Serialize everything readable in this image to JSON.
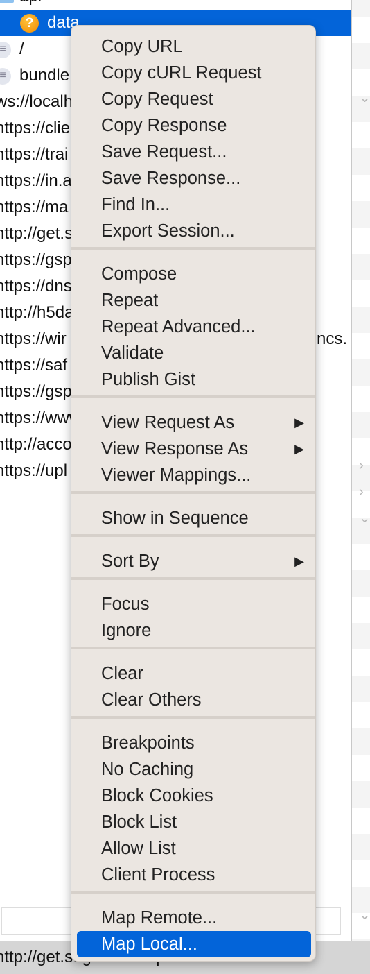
{
  "list": {
    "rows": [
      {
        "text": "api",
        "icon": "folder-icon"
      },
      {
        "text": "data",
        "icon": "question-icon",
        "selected": true
      },
      {
        "text": "/",
        "icon": "document-icon"
      },
      {
        "text": "bundle",
        "icon": "document-icon"
      },
      {
        "text": "ws://localh"
      },
      {
        "text": "https://clie"
      },
      {
        "text": "https://trai"
      },
      {
        "text": "https://in.a"
      },
      {
        "text": "https://ma"
      },
      {
        "text": "http://get.s"
      },
      {
        "text": "https://gsp"
      },
      {
        "text": "https://dns"
      },
      {
        "text": "http://h5da"
      },
      {
        "text": "https://wir",
        "tail": "ncs."
      },
      {
        "text": "https://saf"
      },
      {
        "text": "https://gsp"
      },
      {
        "text": "https://www"
      },
      {
        "text": "http://acco"
      },
      {
        "text": "https://upl"
      }
    ]
  },
  "status": {
    "text": "http://get.sogou.com/q"
  },
  "menu": {
    "groups": [
      [
        "Copy URL",
        "Copy cURL Request",
        "Copy Request",
        "Copy Response",
        "Save Request...",
        "Save Response...",
        "Find In...",
        "Export Session..."
      ],
      [
        "Compose",
        "Repeat",
        "Repeat Advanced...",
        "Validate",
        "Publish Gist"
      ],
      [
        "View Request As",
        "View Response As",
        "Viewer Mappings..."
      ],
      [
        "Show in Sequence"
      ],
      [
        "Sort By"
      ],
      [
        "Focus",
        "Ignore"
      ],
      [
        "Clear",
        "Clear Others"
      ],
      [
        "Breakpoints",
        "No Caching",
        "Block Cookies",
        "Block List",
        "Allow List",
        "Client Process"
      ],
      [
        "Map Remote...",
        "Map Local..."
      ]
    ],
    "submenu_items": [
      "View Request As",
      "View Response As",
      "Sort By"
    ],
    "highlighted": "Map Local..."
  },
  "colors": {
    "accent": "#0364d9",
    "menu_bg": "#ebe6e1"
  }
}
